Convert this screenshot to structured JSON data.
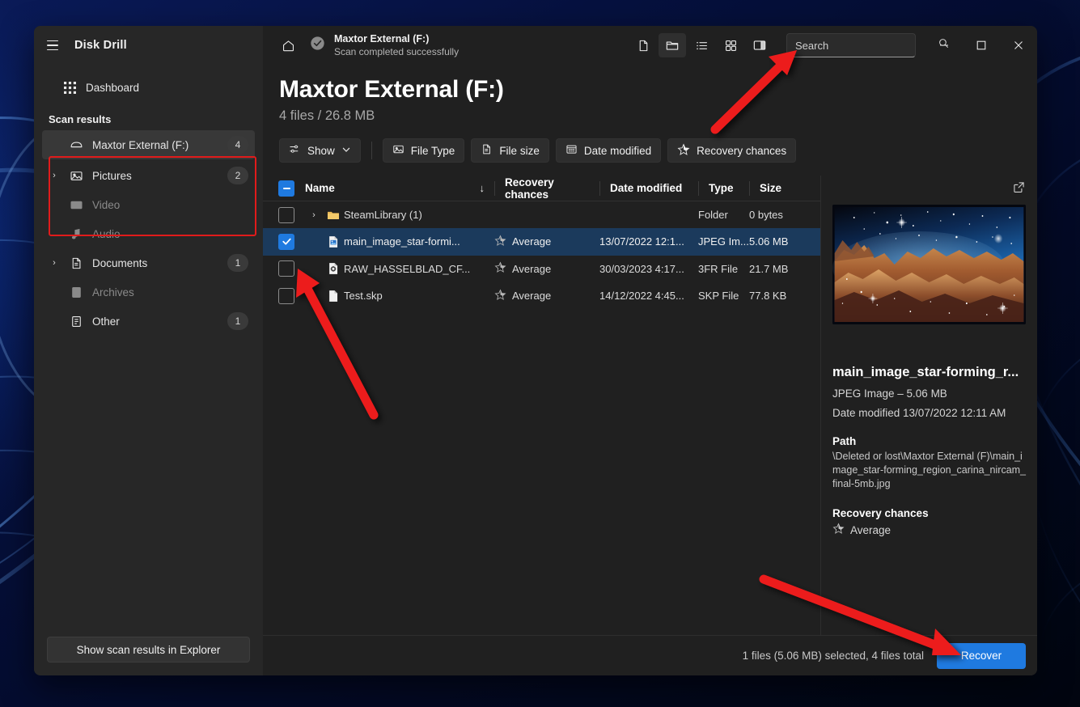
{
  "app": {
    "title": "Disk Drill",
    "accent_color": "#1f7ae0",
    "annotation_color": "#ec1c1c"
  },
  "sidebar": {
    "dashboard_label": "Dashboard",
    "section_label": "Scan results",
    "drive": {
      "label": "Maxtor External (F:)",
      "badge": "4",
      "icon": "drive-icon"
    },
    "categories": [
      {
        "label": "Pictures",
        "badge": "2",
        "icon": "picture-icon",
        "expandable": true,
        "dim": false
      },
      {
        "label": "Video",
        "badge": "",
        "icon": "video-icon",
        "expandable": false,
        "dim": true
      },
      {
        "label": "Audio",
        "badge": "",
        "icon": "audio-icon",
        "expandable": false,
        "dim": true
      },
      {
        "label": "Documents",
        "badge": "1",
        "icon": "document-icon",
        "expandable": true,
        "dim": false
      },
      {
        "label": "Archives",
        "badge": "",
        "icon": "archive-icon",
        "expandable": false,
        "dim": true
      },
      {
        "label": "Other",
        "badge": "1",
        "icon": "other-icon",
        "expandable": false,
        "dim": false
      }
    ],
    "footer_button": "Show scan results in Explorer"
  },
  "titlebar": {
    "scan_title": "Maxtor External (F:)",
    "scan_subtitle": "Scan completed successfully",
    "search_placeholder": "Search",
    "search_value": ""
  },
  "header": {
    "title": "Maxtor External (F:)",
    "subtitle": "4 files / 26.8 MB"
  },
  "filters": {
    "show_label": "Show",
    "chips": [
      {
        "label": "File Type",
        "icon": "image-icon"
      },
      {
        "label": "File size",
        "icon": "file-icon"
      },
      {
        "label": "Date modified",
        "icon": "calendar-icon"
      },
      {
        "label": "Recovery chances",
        "icon": "star-icon"
      }
    ]
  },
  "table": {
    "columns": [
      "Name",
      "Recovery chances",
      "Date modified",
      "Type",
      "Size"
    ],
    "sort_indicator": "↓",
    "rows": [
      {
        "checked": false,
        "expandable": true,
        "icon": "folder-icon",
        "name": "SteamLibrary (1)",
        "recovery": "",
        "date": "",
        "type": "Folder",
        "size": "0 bytes",
        "selected": false
      },
      {
        "checked": true,
        "expandable": false,
        "icon": "jpeg-file-icon",
        "name": "main_image_star-formi...",
        "recovery": "Average",
        "date": "13/07/2022 12:1...",
        "type": "JPEG Im...",
        "size": "5.06 MB",
        "selected": true
      },
      {
        "checked": false,
        "expandable": false,
        "icon": "raw-file-icon",
        "name": "RAW_HASSELBLAD_CF...",
        "recovery": "Average",
        "date": "30/03/2023 4:17...",
        "type": "3FR File",
        "size": "21.7 MB",
        "selected": false
      },
      {
        "checked": false,
        "expandable": false,
        "icon": "blank-file-icon",
        "name": "Test.skp",
        "recovery": "Average",
        "date": "14/12/2022 4:45...",
        "type": "SKP File",
        "size": "77.8 KB",
        "selected": false
      }
    ]
  },
  "preview": {
    "image_alt": "star-forming region carina nircam",
    "filename": "main_image_star-forming_r...",
    "meta": "JPEG Image – 5.06 MB",
    "date_modified": "Date modified 13/07/2022 12:11 AM",
    "path_label": "Path",
    "path_value": "\\Deleted or lost\\Maxtor External (F)\\main_image_star-forming_region_carina_nircam_final-5mb.jpg",
    "recovery_label": "Recovery chances",
    "recovery_value": "Average"
  },
  "statusbar": {
    "text": "1 files (5.06 MB) selected, 4 files total",
    "recover_label": "Recover"
  },
  "window_controls": {
    "minimize": "–",
    "maximize": "▢",
    "close": "✕"
  }
}
